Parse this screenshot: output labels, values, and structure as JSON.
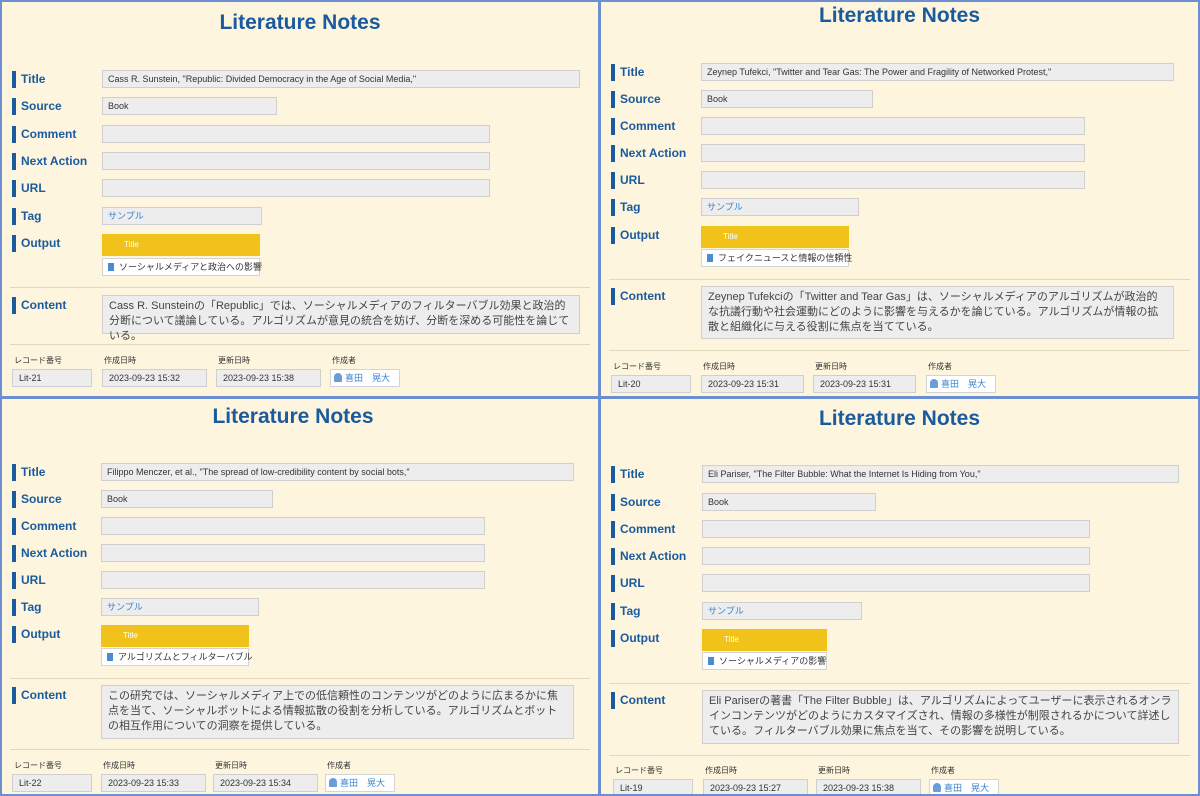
{
  "labels": {
    "title": "Title",
    "source": "Source",
    "comment": "Comment",
    "next_action": "Next Action",
    "url": "URL",
    "tag": "Tag",
    "output": "Output",
    "content": "Content",
    "record_no": "レコード番号",
    "created": "作成日時",
    "updated": "更新日時",
    "author": "作成者",
    "output_header": "Title"
  },
  "panels": [
    {
      "heading": "Literature Notes",
      "title_value": "Cass R. Sunstein, \"Republic: Divided Democracy in the Age of Social Media,\"",
      "source_value": "Book",
      "comment_value": "",
      "next_action_value": "",
      "url_value": "",
      "tag_value": "サンプル",
      "output_item": "ソーシャルメディアと政治への影響",
      "content_text": "Cass R. Sunsteinの「Republic」では、ソーシャルメディアのフィルターバブル効果と政治的分断について議論している。アルゴリズムが意見の統合を妨げ、分断を深める可能性を論じている。",
      "record_no": "Lit-21",
      "created": "2023-09-23 15:32",
      "updated": "2023-09-23 15:38",
      "author": "喜田　晃大"
    },
    {
      "heading": "Literature Notes",
      "title_value": "Zeynep Tufekci, \"Twitter and Tear Gas: The Power and Fragility of Networked Protest,\"",
      "source_value": "Book",
      "comment_value": "",
      "next_action_value": "",
      "url_value": "",
      "tag_value": "サンプル",
      "output_item": "フェイクニュースと情報の信頼性",
      "content_text": "Zeynep Tufekciの「Twitter and Tear Gas」は、ソーシャルメディアのアルゴリズムが政治的な抗議行動や社会運動にどのように影響を与えるかを論じている。アルゴリズムが情報の拡散と組織化に与える役割に焦点を当てている。",
      "record_no": "Lit-20",
      "created": "2023-09-23 15:31",
      "updated": "2023-09-23 15:31",
      "author": "喜田　晃大"
    },
    {
      "heading": "Literature Notes",
      "title_value": "Filippo Menczer, et al., \"The spread of low-credibility content by social bots,\"",
      "source_value": "Book",
      "comment_value": "",
      "next_action_value": "",
      "url_value": "",
      "tag_value": "サンプル",
      "output_item": "アルゴリズムとフィルターバブル",
      "content_text": "この研究では、ソーシャルメディア上での低信頼性のコンテンツがどのように広まるかに焦点を当て、ソーシャルボットによる情報拡散の役割を分析している。アルゴリズムとボットの相互作用についての洞察を提供している。",
      "record_no": "Lit-22",
      "created": "2023-09-23 15:33",
      "updated": "2023-09-23 15:34",
      "author": "喜田　晃大"
    },
    {
      "heading": "Literature Notes",
      "title_value": "Eli Pariser, \"The Filter Bubble: What the Internet Is Hiding from You,\"",
      "source_value": "Book",
      "comment_value": "",
      "next_action_value": "",
      "url_value": "",
      "tag_value": "サンプル",
      "output_item": "ソーシャルメディアの影響",
      "content_text": "Eli Pariserの著書「The Filter Bubble」は、アルゴリズムによってユーザーに表示されるオンラインコンテンツがどのようにカスタマイズされ、情報の多様性が制限されるかについて詳述している。フィルターバブル効果に焦点を当て、その影響を説明している。",
      "record_no": "Lit-19",
      "created": "2023-09-23 15:27",
      "updated": "2023-09-23 15:38",
      "author": "喜田　晃大"
    }
  ],
  "colors": {
    "panel_bg": "#fdf5dd",
    "panel_border": "#6b8fd0",
    "heading": "#1a5a9e",
    "output_header_bg": "#f0c21a",
    "tag_text": "#3a82cc"
  }
}
